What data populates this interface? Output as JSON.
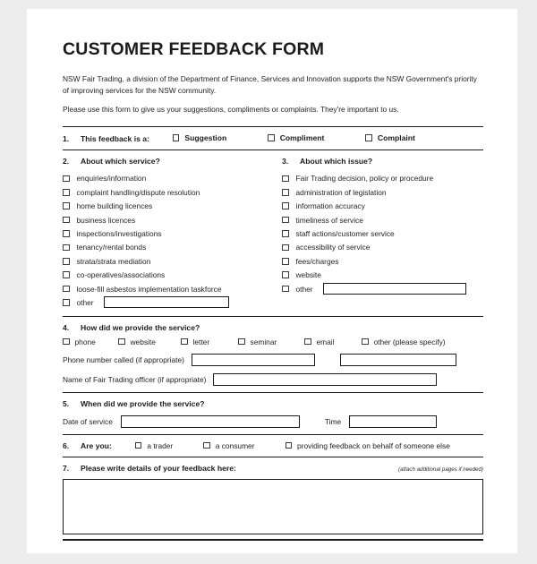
{
  "document": {
    "title": "CUSTOMER FEEDBACK FORM",
    "intro_paragraph_1": "NSW Fair Trading, a division of the Department of Finance, Services and Innovation supports the NSW Government's priority of improving services for the NSW community.",
    "intro_paragraph_2": "Please use this form to give us your suggestions, compliments or complaints. They're important to us."
  },
  "q1": {
    "number": "1.",
    "label": "This feedback is a:",
    "options": [
      {
        "label": "Suggestion"
      },
      {
        "label": "Compliment"
      },
      {
        "label": "Complaint"
      }
    ]
  },
  "q2": {
    "number": "2.",
    "label": "About which service?",
    "items": [
      {
        "label": "enquiries/information"
      },
      {
        "label": "complaint handling/dispute resolution"
      },
      {
        "label": "home building licences"
      },
      {
        "label": "business licences"
      },
      {
        "label": "inspections/investigations"
      },
      {
        "label": "tenancy/rental bonds"
      },
      {
        "label": "strata/strata mediation"
      },
      {
        "label": "co-operatives/associations"
      },
      {
        "label": "loose-fill asbestos implementation taskforce"
      }
    ],
    "other_label": "other",
    "other_value": ""
  },
  "q3": {
    "number": "3.",
    "label": "About which issue?",
    "items": [
      {
        "label": "Fair Trading decision, policy or procedure"
      },
      {
        "label": "administration of legislation"
      },
      {
        "label": "information accuracy"
      },
      {
        "label": "timeliness of service"
      },
      {
        "label": "staff actions/customer service"
      },
      {
        "label": "accessibility of service"
      },
      {
        "label": "fees/charges"
      },
      {
        "label": "website"
      }
    ],
    "other_label": "other",
    "other_value": ""
  },
  "q4": {
    "number": "4.",
    "label": "How did we provide the service?",
    "options": [
      {
        "label": "phone"
      },
      {
        "label": "website"
      },
      {
        "label": "letter"
      },
      {
        "label": "seminar"
      },
      {
        "label": "email"
      },
      {
        "label": "other (please specify)"
      }
    ],
    "phone_label": "Phone number called (if appropriate)",
    "phone_value": "",
    "phone_value_2": "",
    "officer_label": "Name of Fair Trading officer (if appropriate)",
    "officer_value": ""
  },
  "q5": {
    "number": "5.",
    "label": "When did we provide the service?",
    "date_label": "Date of service",
    "date_value": "",
    "time_label": "Time",
    "time_value": ""
  },
  "q6": {
    "number": "6.",
    "label": "Are you:",
    "options": [
      {
        "label": "a trader"
      },
      {
        "label": "a consumer"
      },
      {
        "label": "providing feedback on behalf of someone else"
      }
    ]
  },
  "q7": {
    "number": "7.",
    "label": "Please write details of your feedback here:",
    "note": "(attach additional pages if needed)",
    "value": ""
  }
}
